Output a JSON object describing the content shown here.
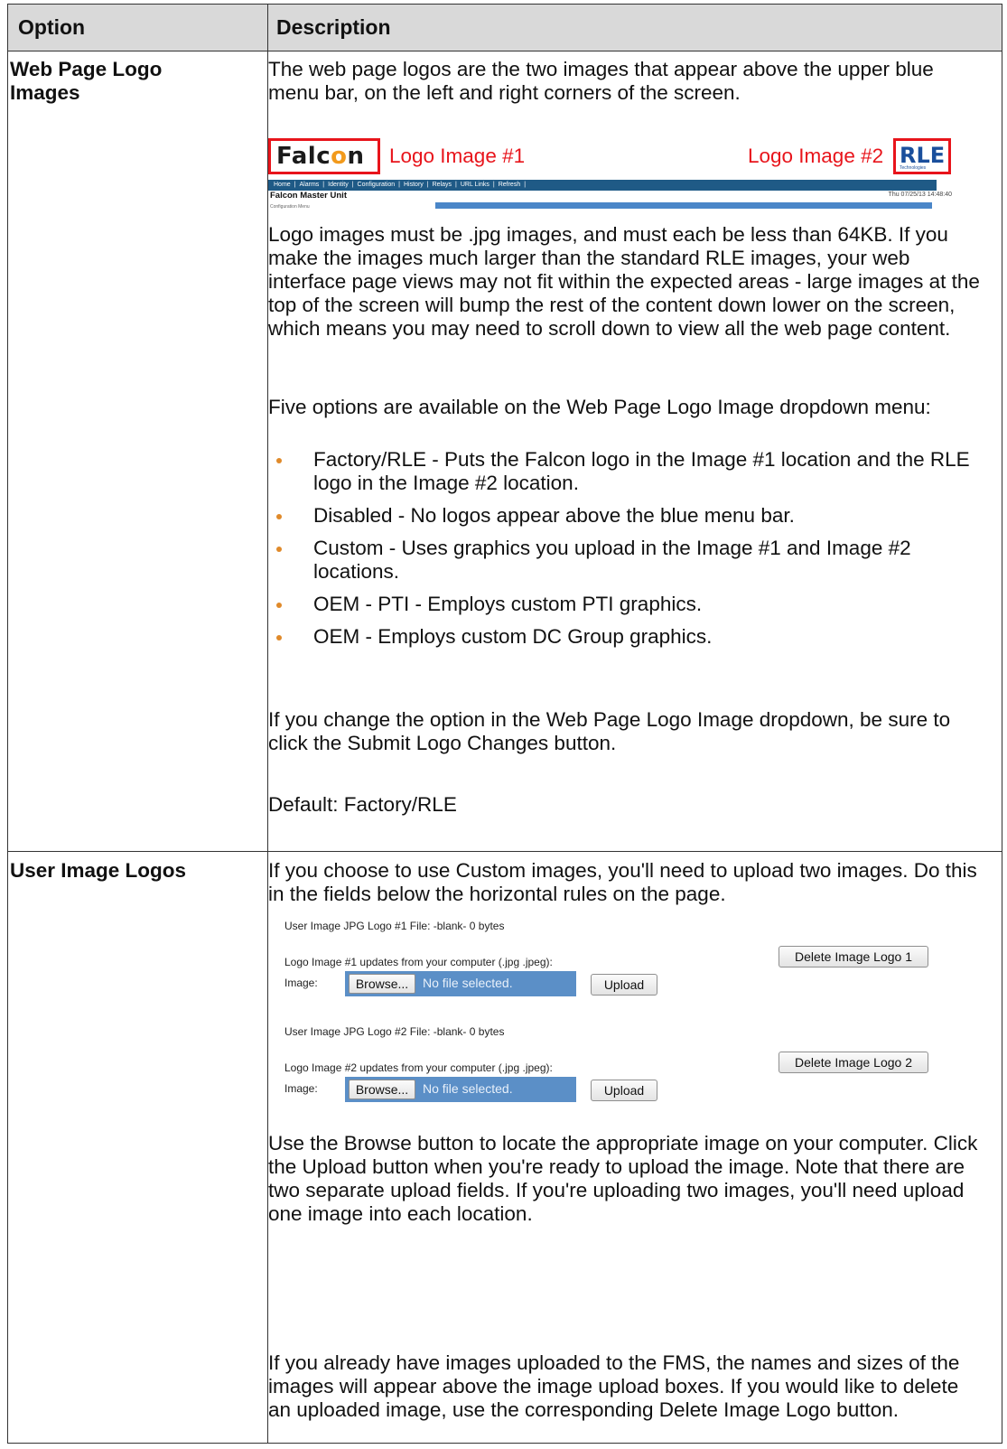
{
  "table": {
    "header": {
      "option": "Option",
      "description": "Description"
    },
    "row1": {
      "option_line1": "Web Page Logo",
      "option_line2": "Images",
      "intro": "The web page logos are the two images that appear above the upper blue menu bar, on the left and right corners of the screen.",
      "screenshot": {
        "falcon_logo_text": "Falc",
        "falcon_logo_o": "o",
        "falcon_logo_end": "n",
        "logo1_label": "Logo Image #1",
        "logo2_label": "Logo Image #2",
        "rle_logo_text": "RLE",
        "rle_logo_sub": "Technologies",
        "menu_items": [
          "Home",
          "|",
          "Alarms",
          "|",
          "Identity",
          "|",
          "Configuration",
          "|",
          "History",
          "|",
          "Relays",
          "|",
          "URL Links",
          "|",
          "Refresh",
          "|"
        ],
        "unit_title": "Falcon Master Unit",
        "date": "Thu 07/25/13 14:48:40",
        "sub_label": "Configuration Menu"
      },
      "para_requirements": "Logo images must be .jpg images, and must each be less than 64KB. If you make the images much larger than the standard RLE images, your web interface page views may not fit within the expected areas - large images at the top of the screen will bump the rest of the content down lower on the screen, which means you may need to scroll down to view all the web page content.",
      "para_options_intro": "Five options are available on the Web Page Logo Image dropdown menu:",
      "bullets": [
        "Factory/RLE - Puts the Falcon logo in the Image #1 location and the RLE logo in the Image #2 location.",
        "Disabled - No logos appear above the blue menu bar.",
        "Custom - Uses graphics you upload in the Image #1 and Image #2 locations.",
        "OEM - PTI - Employs custom PTI graphics.",
        "OEM - Employs custom DC Group graphics."
      ],
      "para_submit": "If you change the option in the Web Page Logo Image dropdown, be sure to click the Submit Logo Changes button.",
      "default": "Default: Factory/RLE"
    },
    "row2": {
      "option": "User Image Logos",
      "intro": "If you choose to use Custom images, you'll need to upload two images. Do this in the fields below the horizontal rules on the page.",
      "form": {
        "logo1_file": "User Image JPG Logo #1 File: -blank- 0 bytes",
        "logo1_updates": "Logo Image #1 updates from your computer (.jpg .jpeg):",
        "image_label": "Image:",
        "browse": "Browse...",
        "no_file": "No file selected.",
        "upload": "Upload",
        "delete1": "Delete Image Logo 1",
        "logo2_file": "User Image JPG Logo #2 File: -blank- 0 bytes",
        "logo2_updates": "Logo Image #2 updates from your computer (.jpg .jpeg):",
        "delete2": "Delete Image Logo 2"
      },
      "para_browse": "Use the Browse button to locate the appropriate image on your computer. Click the Upload button when you're ready to upload the image. Note that there are two separate upload fields. If you're uploading two images, you'll need upload one image into each location.",
      "para_existing": "If you already have images uploaded to the FMS, the names and sizes of the images will appear above the image upload boxes. If you would like to delete an uploaded image, use the corresponding Delete Image Logo button."
    }
  }
}
